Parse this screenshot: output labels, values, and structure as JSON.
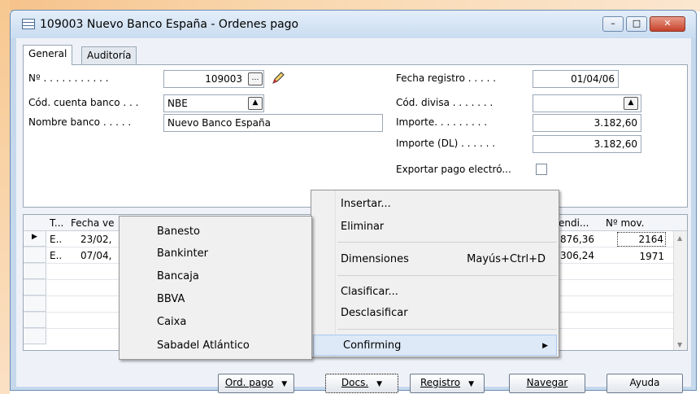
{
  "window": {
    "title": "109003 Nuevo Banco España - Ordenes pago",
    "minimize": "–",
    "maximize": "□",
    "close": "✕"
  },
  "tabs": [
    "General",
    "Auditoría"
  ],
  "form": {
    "no_label": "Nº . . . . . . . . . . .",
    "no_value": "109003",
    "cuenta_label": "Cód. cuenta banco . . .",
    "cuenta_value": "NBE",
    "nombre_label": "Nombre banco . . . . .",
    "nombre_value": "Nuevo Banco España",
    "fecha_label": "Fecha registro . . . . .",
    "fecha_value": "01/04/06",
    "divisa_label": "Cód. divisa . . . . . . .",
    "divisa_value": "",
    "importe_label": "Importe. . . . . . . . .",
    "importe_value": "3.182,60",
    "importe_dl_label": "Importe (DL) . . . . . .",
    "importe_dl_value": "3.182,60",
    "exportar_label": "Exportar pago electró..."
  },
  "grid": {
    "headers": [
      "T...",
      "Fecha ve",
      "endi...",
      "Nº mov."
    ],
    "rows": [
      {
        "t": "E..",
        "fecha": "23/02,",
        "pend": "876,36",
        "mov": "2164"
      },
      {
        "t": "E..",
        "fecha": "07/04,",
        "pend": "306,24",
        "mov": "1971"
      }
    ]
  },
  "docs_menu": {
    "items": [
      {
        "label": "Insertar...",
        "shortcut": ""
      },
      {
        "label": "Eliminar",
        "shortcut": ""
      },
      {
        "label": "Dimensiones",
        "shortcut": "Mayús+Ctrl+D"
      },
      {
        "label": "Clasificar...",
        "shortcut": ""
      },
      {
        "label": "Desclasificar",
        "shortcut": ""
      },
      {
        "label": "Confirming",
        "shortcut": ""
      }
    ]
  },
  "confirming_menu": {
    "items": [
      "Banesto",
      "Bankinter",
      "Bancaja",
      "BBVA",
      "Caixa",
      "Sabadel Atlántico"
    ]
  },
  "buttons": {
    "ord_pago": "Ord. pago",
    "docs": "Docs.",
    "registro": "Registro",
    "navegar": "Navegar",
    "ayuda": "Ayuda"
  }
}
